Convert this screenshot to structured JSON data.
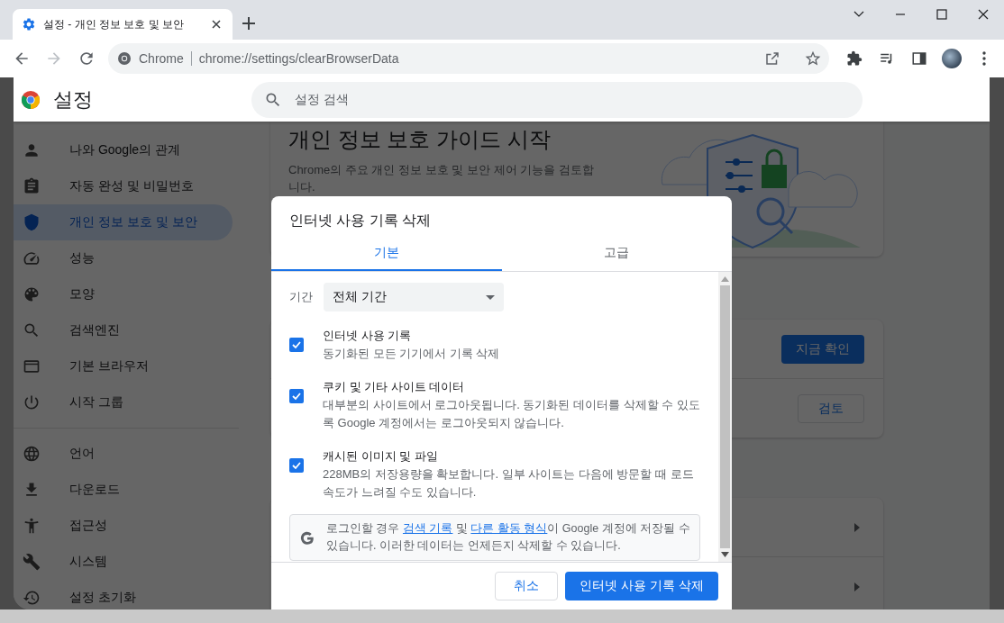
{
  "browser": {
    "tab": {
      "title": "설정 - 개인 정보 보호 및 보안"
    },
    "nav_buttons": [
      {
        "kind": "back",
        "disabled": false
      },
      {
        "kind": "forward",
        "disabled": true
      },
      {
        "kind": "reload",
        "disabled": false
      }
    ],
    "omnibox": {
      "site_label": "Chrome",
      "url": "chrome://settings/clearBrowserData"
    }
  },
  "settings": {
    "title": "설정",
    "search": {
      "placeholder": "설정 검색"
    },
    "sidebar": {
      "groups": [
        [
          {
            "label": "나와 Google의 관계",
            "selected": false
          },
          {
            "label": "자동 완성 및 비밀번호",
            "selected": false
          },
          {
            "label": "개인 정보 보호 및 보안",
            "selected": true
          },
          {
            "label": "성능",
            "selected": false
          },
          {
            "label": "모양",
            "selected": false
          },
          {
            "label": "검색엔진",
            "selected": false
          },
          {
            "label": "기본 브라우저",
            "selected": false
          },
          {
            "label": "시작 그룹",
            "selected": false
          }
        ],
        [
          {
            "label": "언어",
            "selected": false
          },
          {
            "label": "다운로드",
            "selected": false
          },
          {
            "label": "접근성",
            "selected": false
          },
          {
            "label": "시스템",
            "selected": false
          },
          {
            "label": "설정 초기화",
            "selected": false
          }
        ]
      ]
    },
    "privacy_guide": {
      "title": "개인 정보 보호 가이드 시작",
      "description": "Chrome의 주요 개인 정보 보호 및 보안 제어 기능을 검토합니다."
    },
    "safety_check": {
      "buttons": [
        {
          "label": "지금 확인",
          "kind": "primary"
        },
        {
          "label": "검토",
          "kind": "outline"
        }
      ]
    }
  },
  "dialog": {
    "title": "인터넷 사용 기록 삭제",
    "tabs": [
      {
        "label": "기본",
        "selected": true
      },
      {
        "label": "고급",
        "selected": false
      }
    ],
    "period": {
      "label": "기간",
      "value": "전체 기간"
    },
    "options": [
      {
        "title": "인터넷 사용 기록",
        "description": "동기화된 모든 기기에서 기록 삭제",
        "checked": true
      },
      {
        "title": "쿠키 및 기타 사이트 데이터",
        "description": "대부분의 사이트에서 로그아웃됩니다. 동기화된 데이터를 삭제할 수 있도록 Google 계정에서는 로그아웃되지 않습니다.",
        "checked": true
      },
      {
        "title": "캐시된 이미지 및 파일",
        "description": "228MB의 저장용량을 확보합니다. 일부 사이트는 다음에 방문할 때 로드 속도가 느려질 수도 있습니다.",
        "checked": true
      }
    ],
    "notice": {
      "parts": [
        {
          "kind": "text",
          "text": "로그인할 경우 "
        },
        {
          "kind": "link",
          "text": "검색 기록"
        },
        {
          "kind": "text",
          "text": " 및 "
        },
        {
          "kind": "link",
          "text": "다른 활동 형식"
        },
        {
          "kind": "text",
          "text": "이 Google 계정에 저장될 수 있습니다. 이러한 데이터는 언제든지 삭제할 수 있습니다."
        }
      ]
    },
    "buttons": [
      {
        "label": "취소",
        "kind": "secondary"
      },
      {
        "label": "인터넷 사용 기록 삭제",
        "kind": "primary"
      }
    ]
  }
}
